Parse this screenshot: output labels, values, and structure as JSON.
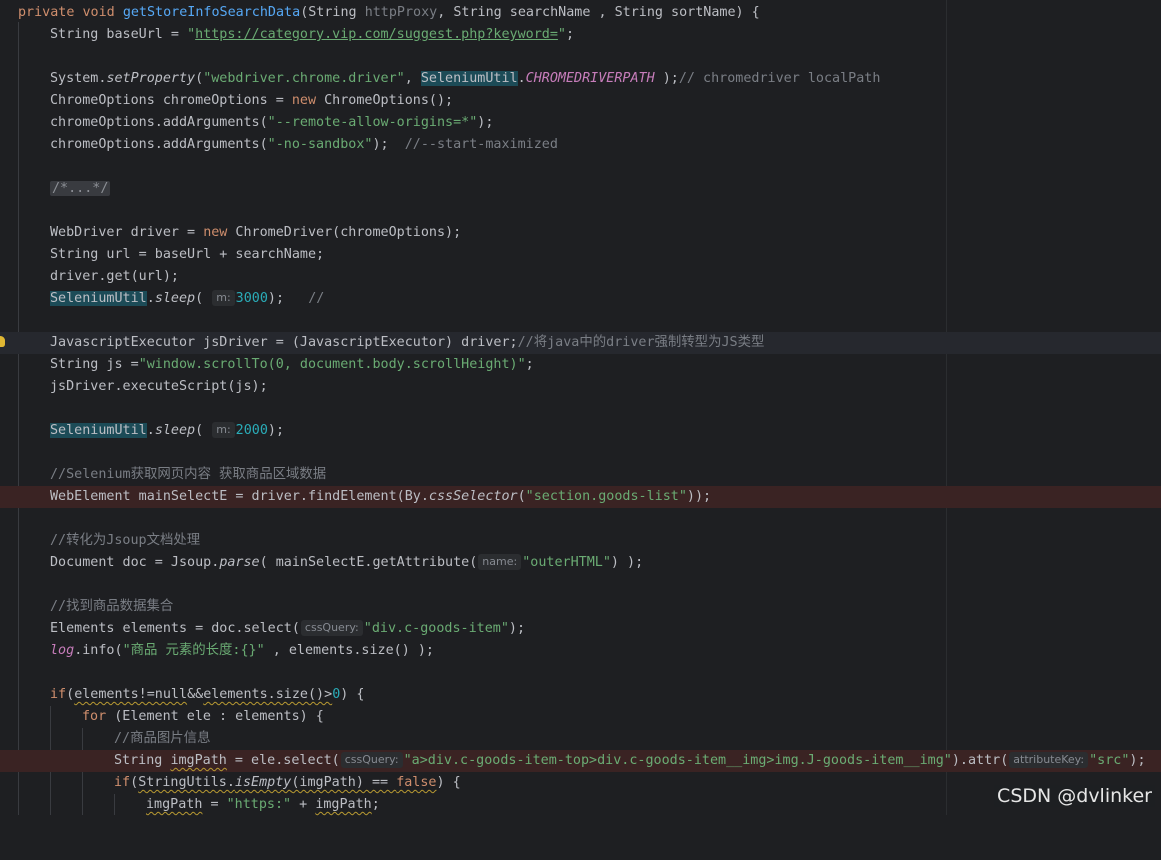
{
  "colors": {
    "background": "#1e1f22",
    "keyword": "#cf8e6d",
    "method_declaration": "#56a8f5",
    "string": "#6aab73",
    "number": "#2aacb8",
    "comment": "#7a7e85",
    "static_field": "#c77dbb",
    "highlight": "#1c4b57",
    "breakpoint_line": "#3a2323"
  },
  "code": {
    "l1": {
      "kw1": "private",
      "kw2": "void",
      "method": "getStoreInfoSearchData",
      "params_a": "(String ",
      "p1": "httpProxy",
      "params_b": ", String searchName , String sortName) {"
    },
    "l2": {
      "a": "String baseUrl = ",
      "q1": "\"",
      "url": "https://category.vip.com/suggest.php?keyword=",
      "q2": "\"",
      "b": ";"
    },
    "l4": {
      "a": "System.",
      "m": "setProperty",
      "b": "(",
      "s": "\"webdriver.chrome.driver\"",
      "c": ", ",
      "cls": "SeleniumUtil",
      "d": ".",
      "field": "CHROMEDRIVERPATH",
      "e": " );",
      "cmt": "// chromedriver localPath"
    },
    "l5": {
      "a": "ChromeOptions chromeOptions = ",
      "kw": "new",
      "b": " ChromeOptions();"
    },
    "l6": {
      "a": "chromeOptions.addArguments(",
      "s": "\"--remote-allow-origins=*\"",
      "b": ");"
    },
    "l7": {
      "a": "chromeOptions.addArguments(",
      "s": "\"-no-sandbox\"",
      "b": ");  ",
      "cmt": "//--start-maximized"
    },
    "l9": {
      "fold": "/*...*/"
    },
    "l11": {
      "a": "WebDriver driver = ",
      "kw": "new",
      "b": " ChromeDriver(chromeOptions);"
    },
    "l12": {
      "a": "String url = baseUrl + searchName;"
    },
    "l13": {
      "a": "driver.get(url);"
    },
    "l14": {
      "cls": "SeleniumUtil",
      "d": ".",
      "m": "sleep",
      "b": "( ",
      "hint": "m:",
      "n": "3000",
      "c": ");   ",
      "cmt": "//"
    },
    "l16": {
      "a": "JavascriptExecutor jsDriver = (JavascriptExecutor) driver;",
      "cmt": "//将java中的driver强制转型为JS类型"
    },
    "l17": {
      "a": "String js =",
      "s": "\"window.scrollTo(0, document.body.scrollHeight)\"",
      "b": ";"
    },
    "l18": {
      "a": "jsDriver.executeScript(js);"
    },
    "l20": {
      "cls": "SeleniumUtil",
      "d": ".",
      "m": "sleep",
      "b": "( ",
      "hint": "m:",
      "n": "2000",
      "c": ");"
    },
    "l22": {
      "cmt": "//Selenium获取网页内容 获取商品区域数据"
    },
    "l23": {
      "a": "WebElement mainSelectE = driver.findElement(By.",
      "m": "cssSelector",
      "b": "(",
      "s": "\"section.goods-list\"",
      "c": "));"
    },
    "l25": {
      "cmt": "//转化为Jsoup文档处理"
    },
    "l26": {
      "a": "Document doc = Jsoup.",
      "m": "parse",
      "b": "( mainSelectE.getAttribute(",
      "hint": "name:",
      "s": "\"outerHTML\"",
      "c": ") );"
    },
    "l28": {
      "cmt": "//找到商品数据集合"
    },
    "l29": {
      "a": "Elements elements = doc.select(",
      "hint": "cssQuery:",
      "s": "\"div.c-goods-item\"",
      "b": ");"
    },
    "l30": {
      "log": "log",
      "a": ".info(",
      "s": "\"商品 元素的长度:{}\"",
      "b": " , elements.size() );"
    },
    "l32": {
      "kw": "if",
      "a": "(",
      "w": "elements!=null",
      "amp": "&&",
      "w2": "elements.size()>",
      "n": "0",
      "b": ") {"
    },
    "l33": {
      "kw": "for",
      "a": " (Element ele : elements) {"
    },
    "l34": {
      "cmt": "//商品图片信息"
    },
    "l35": {
      "a": "String ",
      "w": "imgPath",
      "b": " = ele.select(",
      "hint": "cssQuery:",
      "s": "\"a>div.c-goods-item-top>div.c-goods-item__img>img.J-goods-item__img\"",
      "c": ").attr(",
      "hint2": "attributeKey:",
      "s2": "\"src\"",
      "d": ");"
    },
    "l36": {
      "kw": "if",
      "a": "(",
      "w": "StringUtils.",
      "m": "isEmpty",
      "w2": "(imgPath) == ",
      "kw2": "false",
      "b": ") {"
    },
    "l37": {
      "w": "imgPath",
      "a": " = ",
      "s": "\"https:\"",
      "b": " + ",
      "w2": "imgPath",
      "c": ";"
    }
  },
  "watermark": "CSDN @dvlinker"
}
